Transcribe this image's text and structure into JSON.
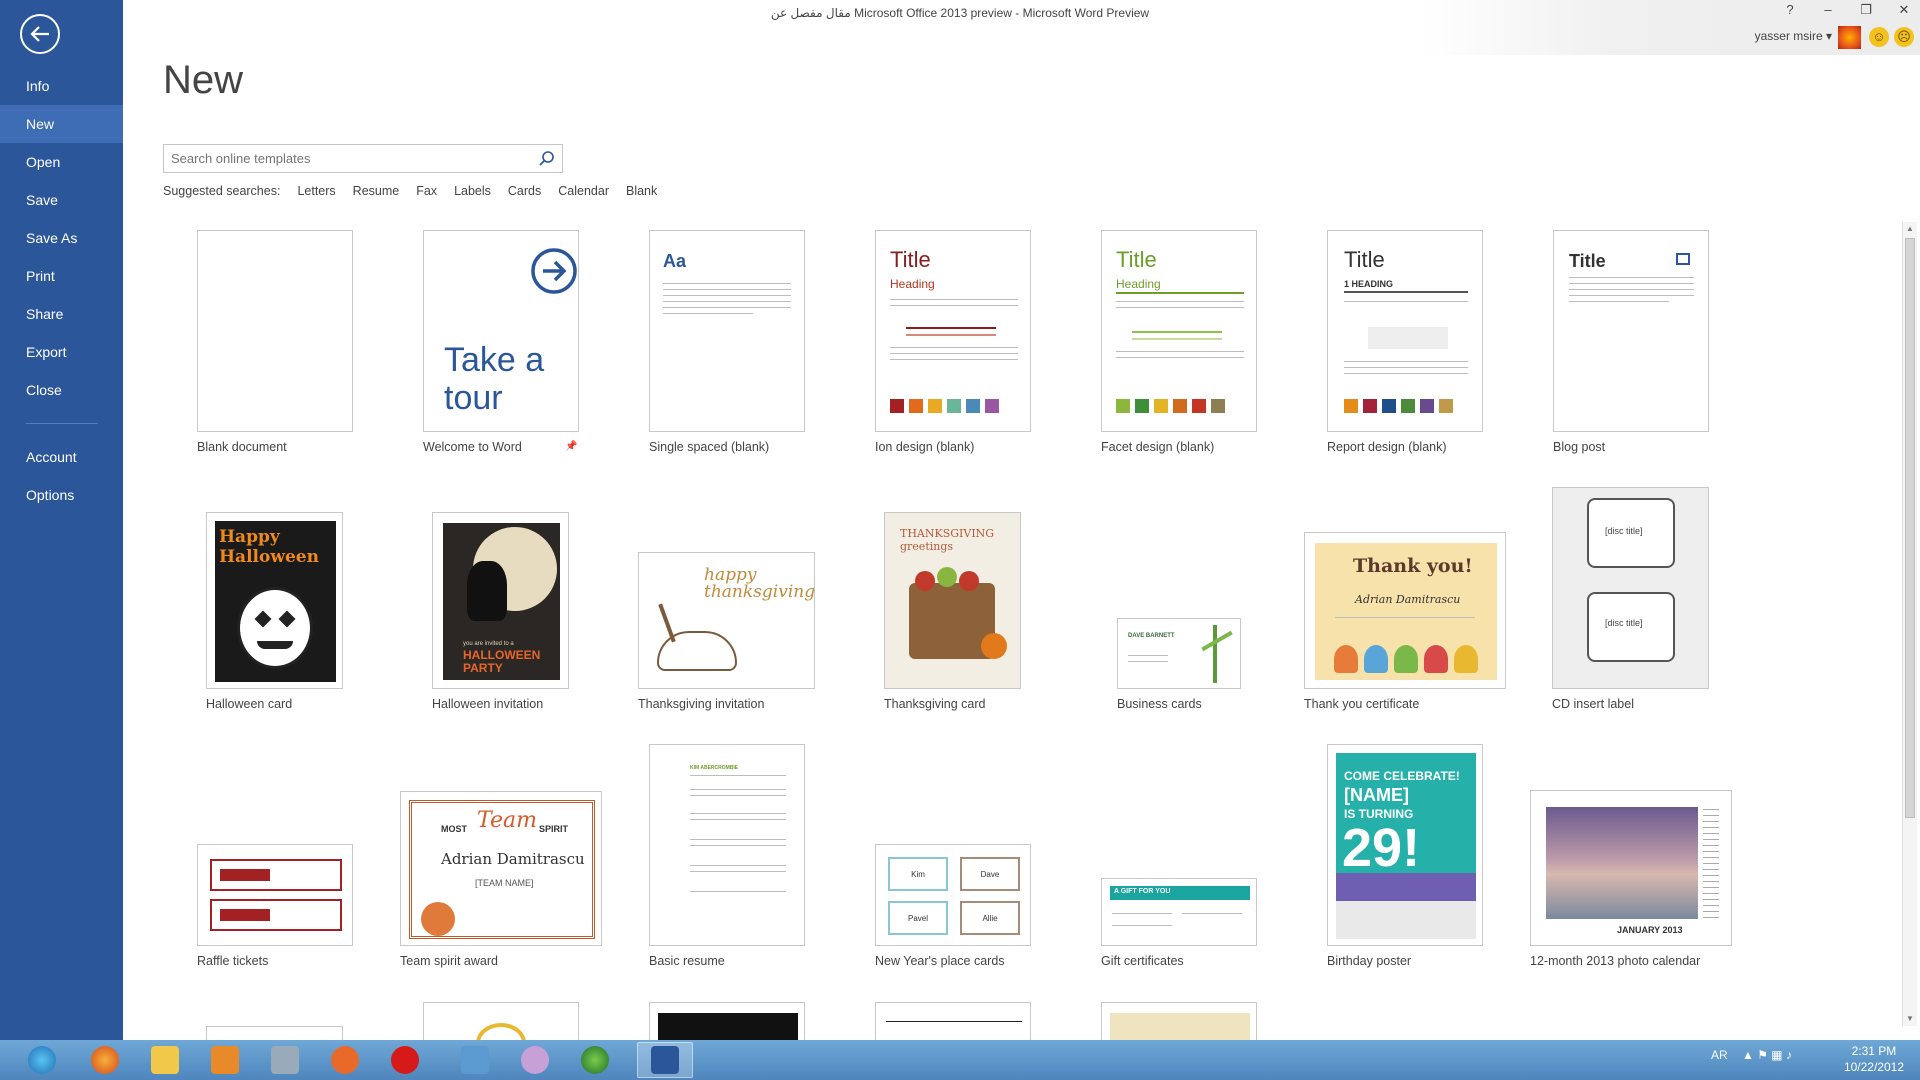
{
  "window": {
    "title": "مقال مفصل عن   Microsoft Office 2013 preview - Microsoft Word Preview",
    "help": "?",
    "minimize": "–",
    "restore": "❐",
    "close": "✕",
    "user": "yasser msire ▾",
    "smile_happy": "☺",
    "smile_sad": "☹"
  },
  "nav": {
    "items": [
      {
        "label": "Info"
      },
      {
        "label": "New"
      },
      {
        "label": "Open"
      },
      {
        "label": "Save"
      },
      {
        "label": "Save As"
      },
      {
        "label": "Print"
      },
      {
        "label": "Share"
      },
      {
        "label": "Export"
      },
      {
        "label": "Close"
      }
    ],
    "items2": [
      {
        "label": "Account"
      },
      {
        "label": "Options"
      }
    ]
  },
  "main": {
    "heading": "New",
    "search_placeholder": "Search online templates",
    "suggested_label": "Suggested searches:",
    "suggested": [
      "Letters",
      "Resume",
      "Fax",
      "Labels",
      "Cards",
      "Calendar",
      "Blank"
    ]
  },
  "templates": {
    "row1": [
      {
        "label": "Blank document"
      },
      {
        "label": "Welcome to Word",
        "text": "Take a tour"
      },
      {
        "label": "Single spaced (blank)",
        "text": "Aa"
      },
      {
        "label": "Ion design (blank)",
        "title": "Title",
        "heading": "Heading"
      },
      {
        "label": "Facet design (blank)",
        "title": "Title",
        "heading": "Heading"
      },
      {
        "label": "Report design (blank)",
        "title": "Title",
        "heading": "1  HEADING"
      },
      {
        "label": "Blog post",
        "title": "Title"
      }
    ],
    "row2": [
      {
        "label": "Halloween card",
        "text": "Happy Halloween"
      },
      {
        "label": "Halloween invitation",
        "text1": "you are invited to a",
        "text2": "HALLOWEEN PARTY"
      },
      {
        "label": "Thanksgiving invitation",
        "text": "happy thanksgiving"
      },
      {
        "label": "Thanksgiving card",
        "text": "THANKSGIVING greetings"
      },
      {
        "label": "Business cards",
        "text": "DAVE BARNETT"
      },
      {
        "label": "Thank you certificate",
        "text1": "Thank you!",
        "text2": "Adrian Damitrascu"
      },
      {
        "label": "CD insert label",
        "text": "[disc title]"
      }
    ],
    "row3": [
      {
        "label": "Raffle tickets"
      },
      {
        "label": "Team spirit award",
        "text1": "MOST",
        "text2": "Team",
        "text3": "SPIRIT",
        "text4": "Adrian Damitrascu",
        "text5": "[TEAM NAME]"
      },
      {
        "label": "Basic resume",
        "text": "KIM ABERCROMBIE"
      },
      {
        "label": "New Year's place cards",
        "names": [
          "Kim",
          "Dave",
          "Pavel",
          "Allie"
        ]
      },
      {
        "label": "Gift certificates",
        "text": "A GIFT FOR YOU"
      },
      {
        "label": "Birthday poster",
        "text1": "COME CELEBRATE!",
        "text2": "[NAME]",
        "text3": "IS TURNING",
        "text4": "29!"
      },
      {
        "label": "12-month 2013 photo calendar",
        "text": "JANUARY 2013"
      }
    ]
  },
  "taskbar": {
    "lang": "AR",
    "time": "2:31 PM",
    "date": "10/22/2012"
  },
  "colors": {
    "accent": "#2b579a",
    "nav_active": "#3e6db5"
  }
}
